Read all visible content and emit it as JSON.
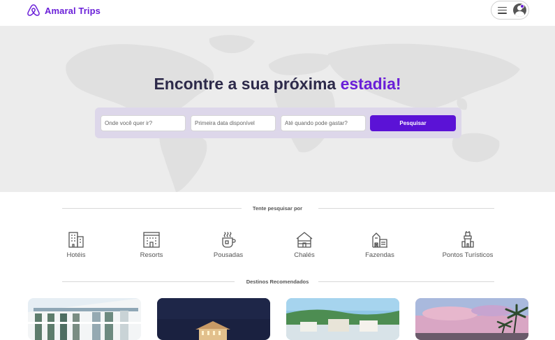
{
  "header": {
    "brand_name": "Amaral Trips",
    "logo_icon": "airbnb-like-logo-icon",
    "accent_color": "#6a1fd8"
  },
  "user_menu": {
    "menu_icon": "hamburger-icon",
    "avatar_icon": "user-avatar-icon",
    "notification_color": "#6a1fd8"
  },
  "hero": {
    "title_prefix": "Encontre a sua próxima ",
    "title_accent": "estadia!",
    "background_icon": "world-map-icon"
  },
  "search": {
    "destination_placeholder": "Onde você quer ir?",
    "start_date_placeholder": "Primeira data disponível",
    "budget_placeholder": "Até quando pode gastar?",
    "submit_label": "Pesquisar",
    "button_color": "#5b12d6"
  },
  "categories_section": {
    "title": "Tente pesquisar por",
    "items": [
      {
        "label": "Hotéis",
        "icon": "hotel-building-icon"
      },
      {
        "label": "Resorts",
        "icon": "resort-building-icon"
      },
      {
        "label": "Pousadas",
        "icon": "hot-drink-cup-icon"
      },
      {
        "label": "Chalés",
        "icon": "cabin-icon"
      },
      {
        "label": "Fazendas",
        "icon": "farm-barn-icon"
      },
      {
        "label": "Pontos Turísticos",
        "icon": "landmark-tower-icon"
      }
    ]
  },
  "destinations_section": {
    "title": "Destinos Recomendados",
    "cards": [
      {
        "image": "hotel-facade-photo"
      },
      {
        "image": "night-building-photo"
      },
      {
        "image": "coastal-town-photo"
      },
      {
        "image": "sunset-palm-trees-photo"
      }
    ]
  }
}
